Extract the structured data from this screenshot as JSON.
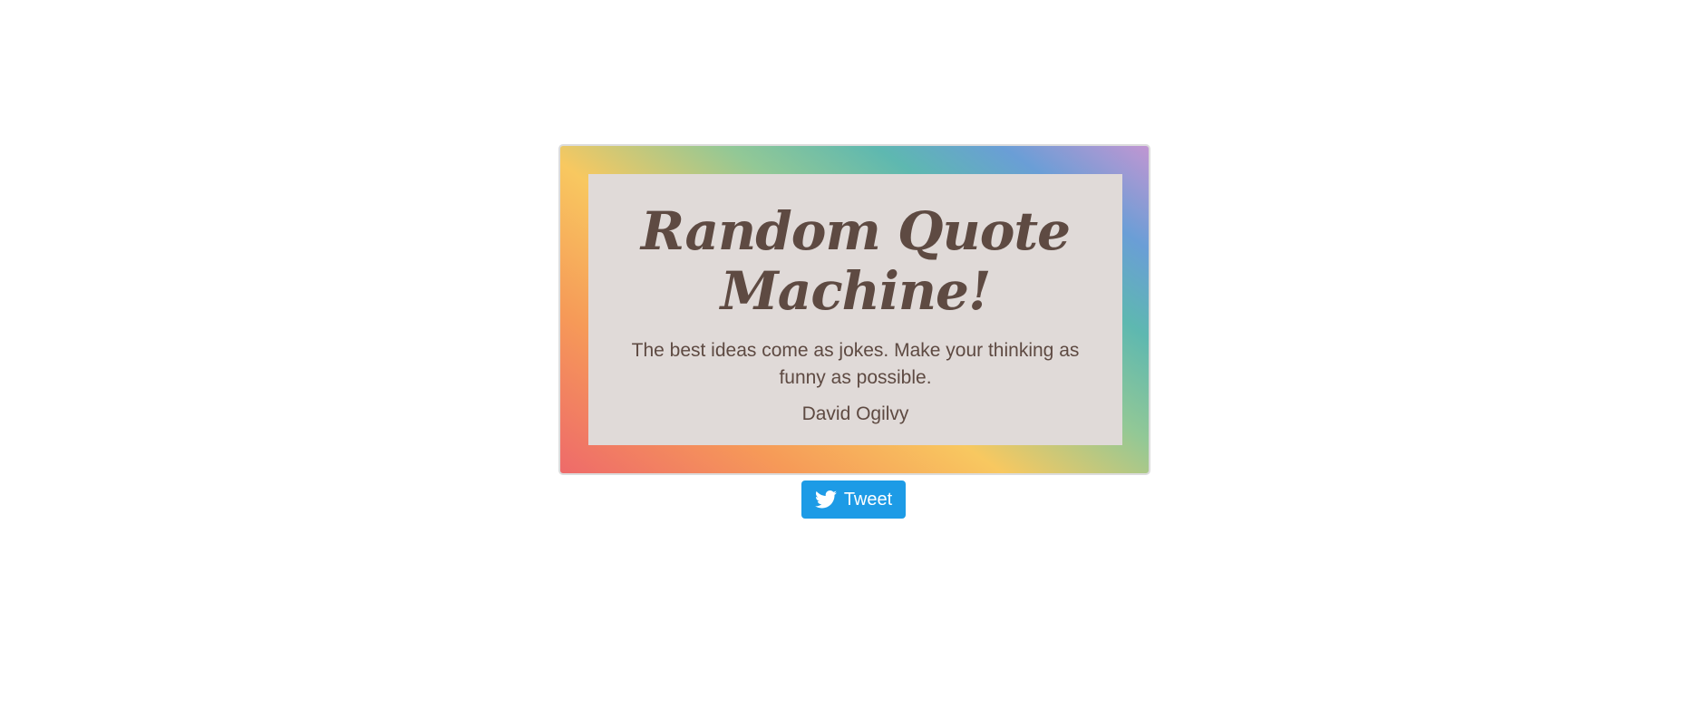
{
  "title_line1": "Random Quote",
  "title_line2": "Machine!",
  "quote": {
    "text": "The best ideas come as jokes. Make your thinking as funny as possible.",
    "author": "David Ogilvy"
  },
  "tweet_button": {
    "label": "Tweet",
    "icon": "twitter-bird-icon",
    "color": "#1d9be6"
  },
  "colors": {
    "text": "#5e4a42",
    "card_background": "#e0dad8",
    "gradient": [
      "#ee6a6a",
      "#f69a58",
      "#f8c860",
      "#92c896",
      "#5eb8b0",
      "#6a9ed6",
      "#c196d2"
    ]
  }
}
